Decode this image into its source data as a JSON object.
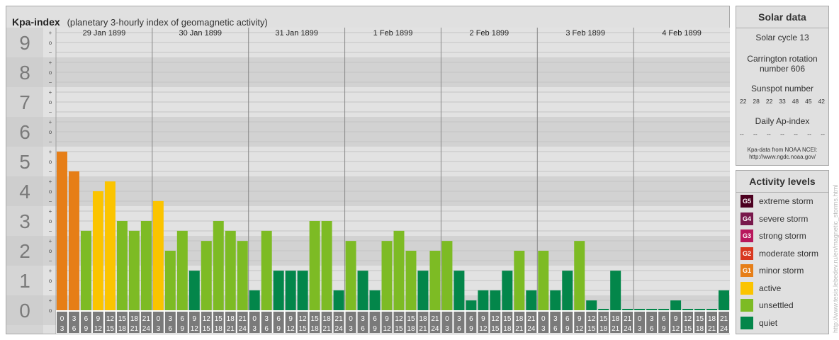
{
  "header": {
    "title": "Kpa-index",
    "subtitle": "(planetary 3-hourly index of geomagnetic activity)"
  },
  "chart_data": {
    "type": "bar",
    "title": "Kpa-index",
    "subtitle": "(planetary 3-hourly index of geomagnetic activity)",
    "ylim": [
      0,
      9
    ],
    "y_ticks": [
      "0",
      "1",
      "2",
      "3",
      "4",
      "5",
      "6",
      "7",
      "8",
      "9"
    ],
    "minor_ticks": [
      "o",
      "+",
      "−"
    ],
    "days": [
      "29 Jan 1899",
      "30 Jan 1899",
      "31 Jan 1899",
      "1 Feb 1899",
      "2 Feb 1899",
      "3 Feb 1899",
      "4 Feb 1899"
    ],
    "interval_starts": [
      "0",
      "3",
      "6",
      "9",
      "12",
      "15",
      "18",
      "21"
    ],
    "interval_ends": [
      "3",
      "6",
      "9",
      "12",
      "15",
      "18",
      "21",
      "24"
    ],
    "values": [
      5.33,
      4.67,
      2.67,
      4.0,
      4.33,
      3.0,
      2.67,
      3.0,
      3.67,
      2.0,
      2.67,
      1.33,
      2.33,
      3.0,
      2.67,
      2.33,
      0.67,
      2.67,
      1.33,
      1.33,
      1.33,
      3.0,
      3.0,
      0.67,
      2.33,
      1.33,
      0.67,
      2.33,
      2.67,
      2.0,
      1.33,
      2.0,
      2.33,
      1.33,
      0.33,
      0.67,
      0.67,
      1.33,
      2.0,
      0.67,
      2.0,
      0.67,
      1.33,
      2.33,
      0.33,
      0.0,
      1.33,
      0.0,
      0.0,
      0.0,
      0.0,
      0.33,
      0.0,
      0.0,
      0.0,
      0.67
    ],
    "colors": {
      "quiet": "#03864a",
      "unsettled": "#7dbb24",
      "active": "#fbc400",
      "minor": "#e67e17"
    },
    "thresholds": {
      "unsettled": 2,
      "active": 3.67,
      "minor": 4.67
    }
  },
  "solar": {
    "title": "Solar data",
    "cycle": "Solar cycle 13",
    "carrington_1": "Carrington rotation",
    "carrington_2": "number 606",
    "sunspot_title": "Sunspot number",
    "sunspots": [
      "22",
      "28",
      "22",
      "33",
      "48",
      "45",
      "42"
    ],
    "ap_title": "Daily Ap-index",
    "ap": [
      "--",
      "--",
      "--",
      "--",
      "--",
      "--",
      "--"
    ],
    "credit_1": "Kpa-data from NOAA NCEI:",
    "credit_2": "http://www.ngdc.noaa.gov/"
  },
  "levels": {
    "title": "Activity levels",
    "items": [
      {
        "code": "G5",
        "label": "extreme storm",
        "color": "#4c0020"
      },
      {
        "code": "G4",
        "label": "severe storm",
        "color": "#78184b"
      },
      {
        "code": "G3",
        "label": "strong storm",
        "color": "#b8175c"
      },
      {
        "code": "G2",
        "label": "moderate storm",
        "color": "#d8381f"
      },
      {
        "code": "G1",
        "label": "minor storm",
        "color": "#e67e17"
      },
      {
        "code": "",
        "label": "active",
        "color": "#fbc400"
      },
      {
        "code": "",
        "label": "unsettled",
        "color": "#7dbb24"
      },
      {
        "code": "",
        "label": "quiet",
        "color": "#03864a"
      }
    ]
  },
  "watermark": "http://www.tesis.lebedev.ru/en/magnetic_storms.html"
}
